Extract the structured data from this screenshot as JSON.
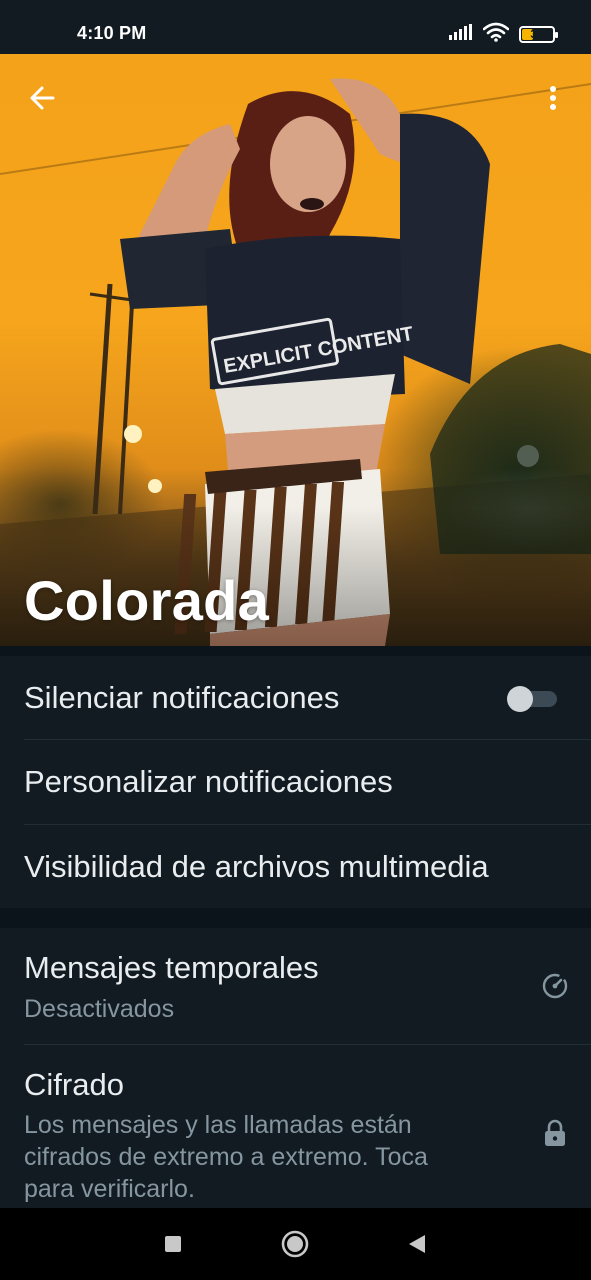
{
  "status_bar": {
    "time": "4:10 PM",
    "battery_level": "36",
    "icons": [
      "signal-icon",
      "wifi-icon",
      "battery-icon"
    ]
  },
  "header": {
    "back_icon": "arrow-left-icon",
    "menu_icon": "more-vertical-icon",
    "contact_name": "Colorada",
    "photo_text": "EXPLICIT CONTENT"
  },
  "notifications": {
    "mute_label": "Silenciar notificaciones",
    "mute_enabled": false,
    "custom_label": "Personalizar notificaciones",
    "media_visibility_label": "Visibilidad de archivos multimedia"
  },
  "privacy": {
    "disappearing_title": "Mensajes temporales",
    "disappearing_status": "Desactivados",
    "disappearing_icon": "timer-icon",
    "encryption_title": "Cifrado",
    "encryption_line1": "Los mensajes y las llamadas están",
    "encryption_line2": "cifrados de extremo a extremo. Toca",
    "encryption_line3": "para verificarlo.",
    "encryption_icon": "lock-icon"
  },
  "nav_bar": {
    "icons": [
      "recents-square-icon",
      "home-circle-icon",
      "back-triangle-icon"
    ]
  },
  "colors": {
    "background": "#0b141a",
    "panel": "#111b21",
    "primary_text": "#e9edef",
    "secondary_text": "#8696a0",
    "hero_orange": "#f6a51c"
  }
}
